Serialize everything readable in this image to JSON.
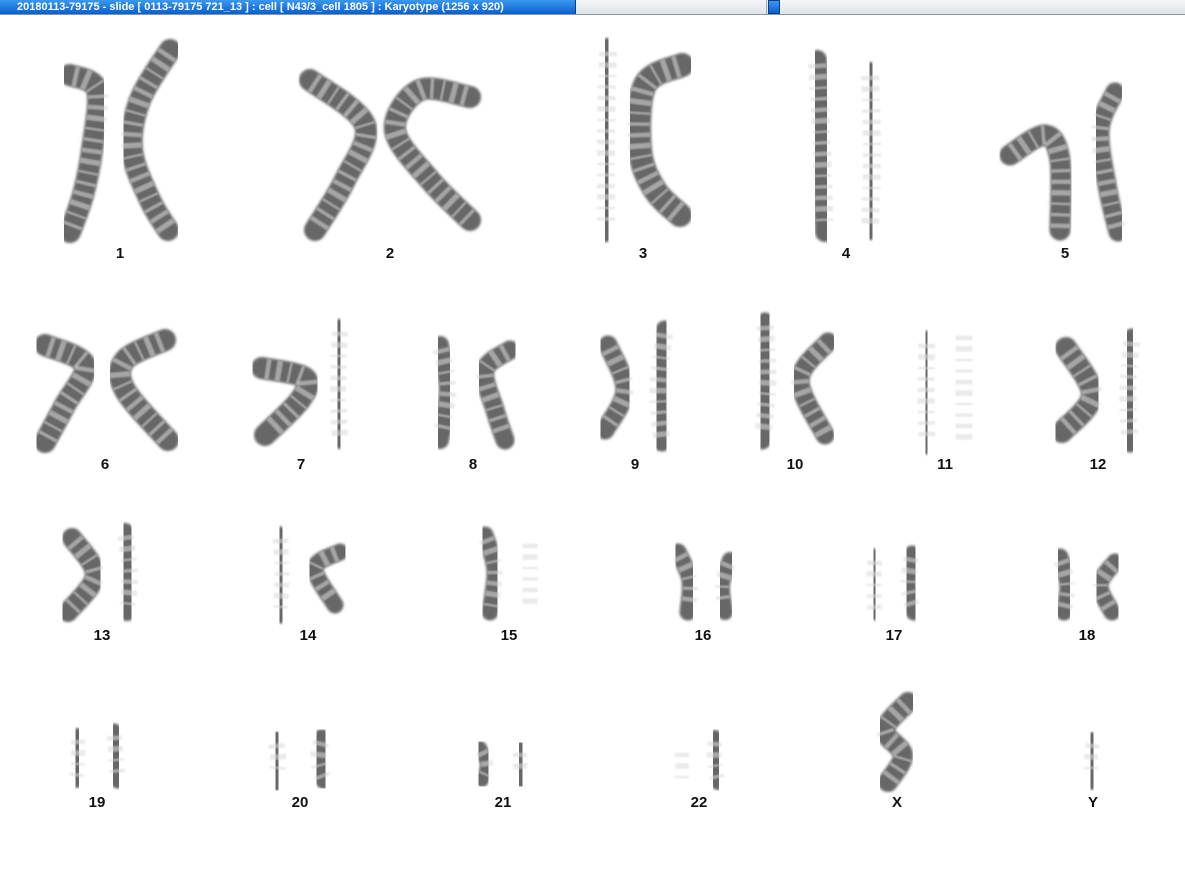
{
  "window": {
    "title": "20180113-79175 - slide [ 0113-79175 721_13 ] : cell [ N43/3_cell 1805 ] : Karyotype  (1256 x 920)"
  },
  "colors": {
    "background": "#ffffff",
    "title_bar": "#0a5fd0",
    "chromosome": "#3c3c3c"
  },
  "karyotype": {
    "labels": [
      "1",
      "2",
      "3",
      "4",
      "5",
      "6",
      "7",
      "8",
      "9",
      "10",
      "11",
      "12",
      "13",
      "14",
      "15",
      "16",
      "17",
      "18",
      "19",
      "20",
      "21",
      "22",
      "X",
      "Y"
    ]
  }
}
